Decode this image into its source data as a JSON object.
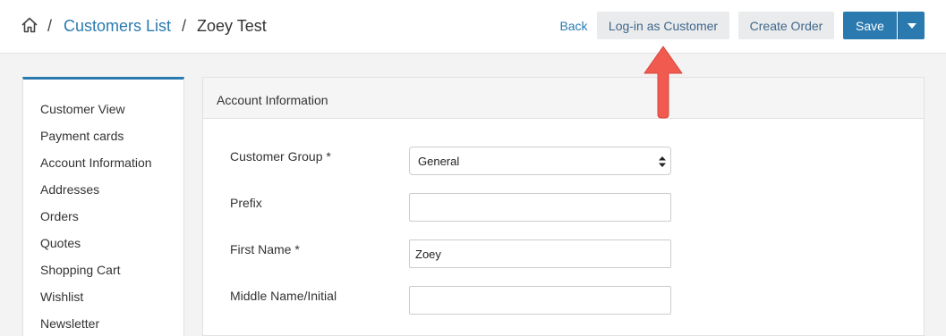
{
  "breadcrumb": {
    "home_icon": "home-icon",
    "separator": "/",
    "link": "Customers List",
    "current": "Zoey Test"
  },
  "toolbar": {
    "back_label": "Back",
    "login_as_customer_label": "Log-in as Customer",
    "create_order_label": "Create Order",
    "save_label": "Save",
    "save_dropdown_icon": "caret-down-icon"
  },
  "sidebar": {
    "items": [
      {
        "label": "Customer View"
      },
      {
        "label": "Payment cards"
      },
      {
        "label": "Account Information"
      },
      {
        "label": "Addresses"
      },
      {
        "label": "Orders"
      },
      {
        "label": "Quotes"
      },
      {
        "label": "Shopping Cart"
      },
      {
        "label": "Wishlist"
      },
      {
        "label": "Newsletter"
      }
    ]
  },
  "panel": {
    "title": "Account Information",
    "fields": {
      "customer_group": {
        "label": "Customer Group *",
        "value": "General"
      },
      "prefix": {
        "label": "Prefix",
        "value": ""
      },
      "first_name": {
        "label": "First Name *",
        "value": "Zoey"
      },
      "middle_name": {
        "label": "Middle Name/Initial",
        "value": ""
      }
    }
  },
  "colors": {
    "accent": "#2a7ab0",
    "annotation_arrow": "#f05a4f"
  }
}
